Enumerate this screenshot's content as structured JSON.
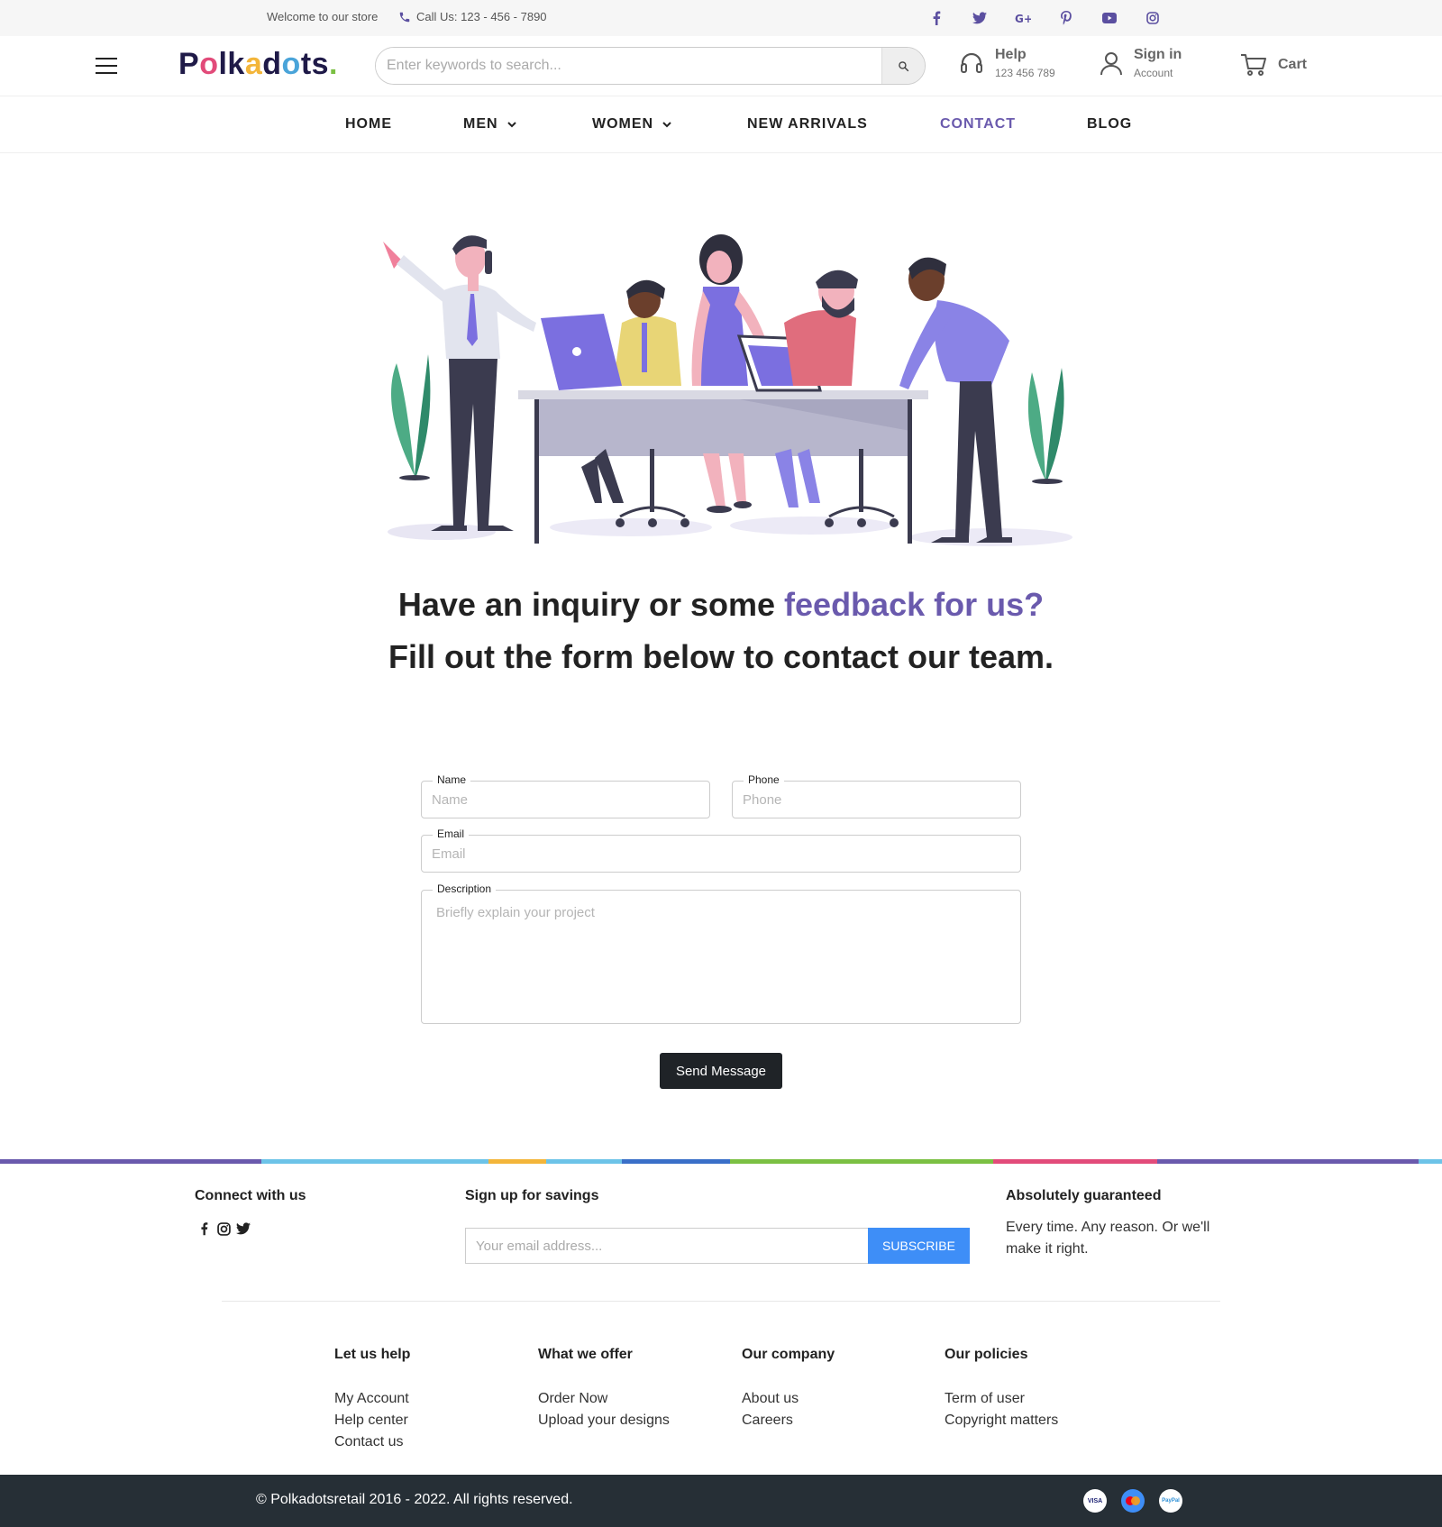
{
  "topbar": {
    "welcome": "Welcome to our store",
    "call": "Call Us: 123 - 456 - 7890",
    "socials": [
      "facebook-icon",
      "twitter-icon",
      "google-plus-icon",
      "pinterest-icon",
      "youtube-icon",
      "instagram-icon"
    ]
  },
  "header": {
    "logo": "Polkadots.",
    "search_placeholder": "Enter keywords to search...",
    "help_title": "Help",
    "help_sub": "123 456 789",
    "signin_title": "Sign in",
    "signin_sub": "Account",
    "cart": "Cart"
  },
  "nav": {
    "home": "HOME",
    "men": "MEN",
    "women": "WOMEN",
    "new_arrivals": "NEW ARRIVALS",
    "contact": "CONTACT",
    "blog": "BLOG"
  },
  "hero": {
    "line1_part1": "Have an inquiry or some ",
    "line1_accent": "feedback for us?",
    "line2": "Fill out the form below to contact our team."
  },
  "form": {
    "name_label": "Name",
    "name_placeholder": "Name",
    "phone_label": "Phone",
    "phone_placeholder": "Phone",
    "email_label": "Email",
    "email_placeholder": "Email",
    "desc_label": "Description",
    "desc_placeholder": "Briefly explain your project",
    "send": "Send Message"
  },
  "footer": {
    "connect_title": "Connect with us",
    "signup_title": "Sign up for savings",
    "email_placeholder": "Your email address...",
    "subscribe": "SUBSCRIBE",
    "guarantee_title": "Absolutely guaranteed",
    "guarantee_text": "Every time. Any reason. Or we'll make it right.",
    "columns": [
      {
        "title": "Let us help",
        "links": [
          "My Account",
          "Help center",
          "Contact us"
        ]
      },
      {
        "title": "What we offer",
        "links": [
          "Order Now",
          "Upload your designs"
        ]
      },
      {
        "title": "Our company",
        "links": [
          "About us",
          "Careers"
        ]
      },
      {
        "title": "Our policies",
        "links": [
          "Term of user",
          "Copyright matters"
        ]
      }
    ],
    "copyright": "© Polkadotsretail 2016 - 2022. All rights reserved.",
    "payments": [
      "VISA",
      "MasterCard",
      "PayPal"
    ]
  },
  "colors": {
    "accent": "#6a5aad",
    "dark": "#1f2327",
    "subscribe_blue": "#3e8ef7",
    "bottom_bar": "#262f36"
  }
}
